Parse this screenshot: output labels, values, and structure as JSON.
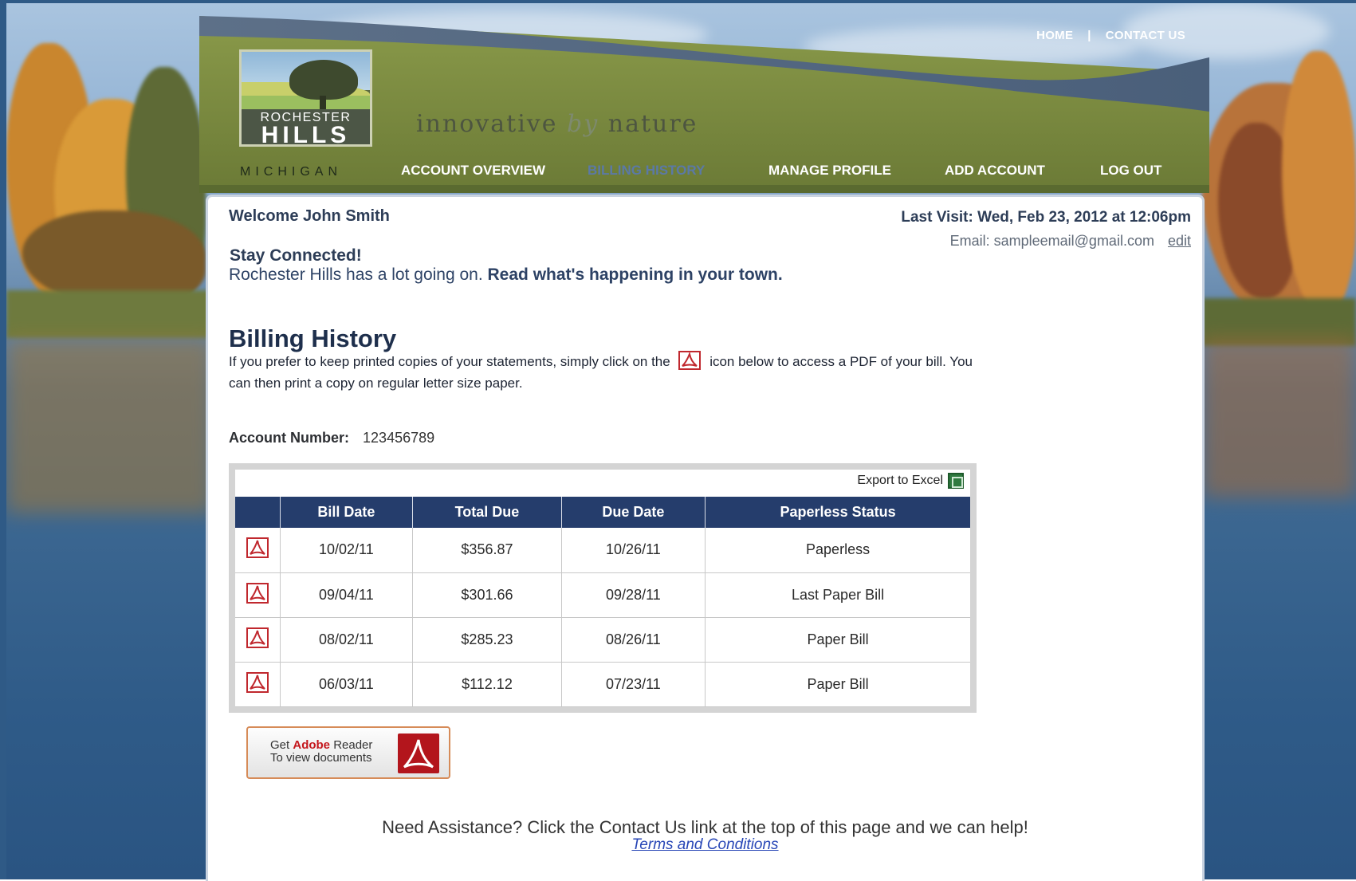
{
  "header": {
    "top_links": {
      "home": "HOME",
      "separator": "|",
      "contact": "CONTACT US"
    },
    "logo": {
      "line1": "ROCHESTER",
      "line2": "HILLS",
      "line3": "MICHIGAN"
    },
    "tagline": {
      "part1": "innovative",
      "part2": "by",
      "part3": "nature"
    },
    "nav": [
      {
        "label": "ACCOUNT OVERVIEW",
        "active": false
      },
      {
        "label": "BILLING HISTORY",
        "active": true
      },
      {
        "label": "MANAGE PROFILE",
        "active": false
      },
      {
        "label": "ADD ACCOUNT",
        "active": false
      },
      {
        "label": "LOG OUT",
        "active": false
      }
    ]
  },
  "user": {
    "welcome": "Welcome John Smith",
    "last_visit": "Last Visit: Wed, Feb 23, 2012 at 12:06pm",
    "email_label": "Email: sampleemail@gmail.com",
    "edit_label": "edit"
  },
  "stay": {
    "title": "Stay Connected!",
    "text": "Rochester Hills has a lot going on.",
    "link": "Read what's happening in your town."
  },
  "billing": {
    "title": "Billing History",
    "desc_part1": "If you prefer to keep printed copies of your statements, simply click on the",
    "desc_part2": "icon below to access a PDF of your bill. You can then print a copy on regular letter size paper.",
    "account_label": "Account Number:",
    "account_number": "123456789",
    "export_label": "Export to Excel",
    "columns": [
      "",
      "Bill Date",
      "Total Due",
      "Due Date",
      "Paperless Status"
    ],
    "rows": [
      {
        "bill_date": "10/02/11",
        "total_due": "$356.87",
        "due_date": "10/26/11",
        "status": "Paperless",
        "status_type": "paperless"
      },
      {
        "bill_date": "09/04/11",
        "total_due": "$301.66",
        "due_date": "09/28/11",
        "status": "Last Paper Bill",
        "status_type": "last"
      },
      {
        "bill_date": "08/02/11",
        "total_due": "$285.23",
        "due_date": "08/26/11",
        "status": "Paper Bill",
        "status_type": "paper"
      },
      {
        "bill_date": "06/03/11",
        "total_due": "$112.12",
        "due_date": "07/23/11",
        "status": "Paper Bill",
        "status_type": "paper"
      }
    ]
  },
  "adobe": {
    "line1_a": "Get ",
    "line1_b": "Adobe",
    "line1_c": " Reader",
    "line2": "To view documents"
  },
  "footer": {
    "assist": "Need Assistance? Click the Contact Us link at the top of this page and we can help!",
    "terms": "Terms and Conditions"
  },
  "colors": {
    "nav_active": "#5b79a6",
    "table_header": "#253d6c",
    "paperless": "#2e8a2e",
    "last_paper": "#9b1c1c",
    "pdf_red": "#c0282e"
  },
  "icons": {
    "pdf": "pdf-icon",
    "excel": "excel-icon",
    "adobe": "adobe-reader-icon"
  }
}
